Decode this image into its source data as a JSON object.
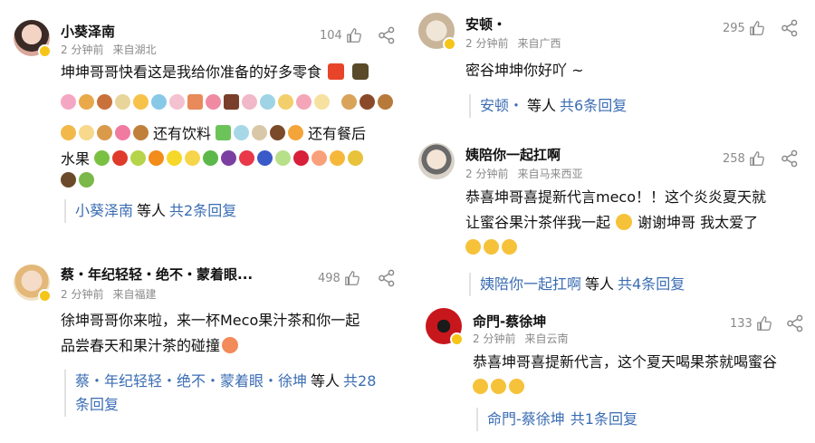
{
  "comments": [
    {
      "name": "小葵泽南",
      "time": "2 分钟前",
      "location": "来自湖北",
      "likes": "104",
      "text_line1": "坤坤哥哥快看这是我给你准备的好多零食",
      "text_mid1": "还有饮料",
      "text_mid2": "还有餐后",
      "text_line3": "水果",
      "reply_name": "小葵泽南",
      "reply_mid": "等人",
      "reply_count": "共2条回复",
      "avatar_icon": "girl-avatar-icon",
      "colors": {
        "avatar": "#d9a89b"
      }
    },
    {
      "name": "蔡・年纪轻轻・绝不・蒙着眼...",
      "time": "2 分钟前",
      "location": "来自福建",
      "likes": "498",
      "text_line1": "徐坤哥哥你来啦，来一杯Meco果汁茶和你一起",
      "text_line2": "品尝春天和果汁茶的碰撞",
      "reply_name_line1": "蔡・年纪轻轻・绝不・蒙着眼・徐坤",
      "reply_mid": "等人",
      "reply_count_line1": "共28",
      "reply_count_line2": "条回复",
      "avatar_icon": "boy-avatar-icon",
      "colors": {
        "avatar": "#e8c39a"
      }
    },
    {
      "name": "安顿・",
      "time": "2 分钟前",
      "location": "来自广西",
      "likes": "295",
      "text_line1": "密谷坤坤你好吖 ~",
      "reply_name": "安顿・",
      "reply_mid": "等人",
      "reply_count": "共6条回复",
      "avatar_icon": "cat-avatar-icon",
      "colors": {
        "avatar": "#c9b59a"
      }
    },
    {
      "name": "姨陪你一起扛啊",
      "time": "2 分钟前",
      "location": "来自马来西亚",
      "likes": "258",
      "text_line1": "恭喜坤哥喜提新代言meco！！这个炎炎夏天就",
      "text_line2a": "让蜜谷果汁茶伴我一起",
      "text_line2b": "谢谢坤哥 我太爱了",
      "reply_name": "姨陪你一起扛啊",
      "reply_mid": "等人",
      "reply_count": "共4条回复",
      "avatar_icon": "person-avatar-icon",
      "colors": {
        "avatar": "#d8d2c8"
      }
    },
    {
      "name": "命門-蔡徐坤",
      "time": "2 分钟前",
      "location": "来自云南",
      "likes": "133",
      "text_line1": "恭喜坤哥喜提新代言，这个夏天喝果茶就喝蜜谷",
      "reply_name": "命門-蔡徐坤",
      "reply_mid": "",
      "reply_count": "共1条回复",
      "avatar_icon": "red-logo-avatar-icon",
      "colors": {
        "avatar": "#c8161d"
      }
    }
  ],
  "icons": {
    "like": "thumbs-up-icon",
    "share": "share-icon",
    "badge": "verified-badge-icon"
  },
  "colors": {
    "reply_link": "#3b6db3",
    "meta": "#8a8a8a",
    "divider": "#e2e2e2",
    "badge": "#f5c518"
  }
}
